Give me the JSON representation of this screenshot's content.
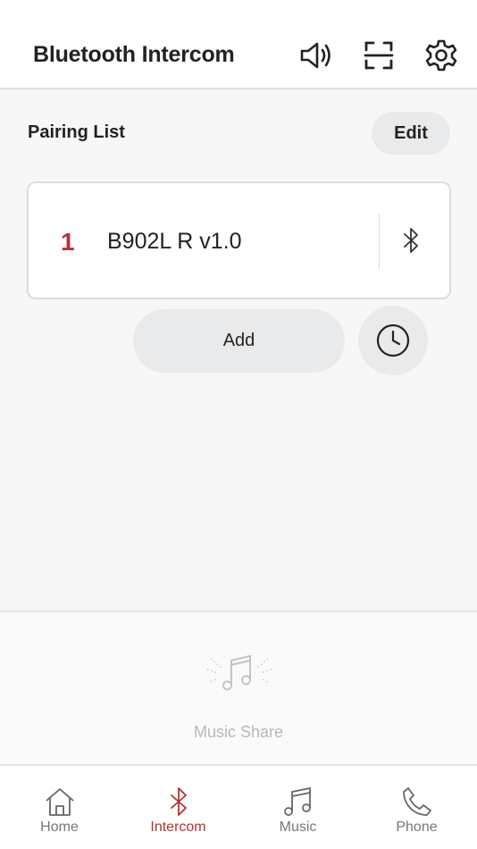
{
  "header": {
    "title": "Bluetooth Intercom",
    "icons": [
      "speaker-volume-icon",
      "scan-icon",
      "gear-icon"
    ]
  },
  "pairing": {
    "section_title": "Pairing List",
    "edit_label": "Edit",
    "items": [
      {
        "number": "1",
        "name": "B902L R v1.0",
        "icon": "bluetooth-icon"
      }
    ],
    "add_label": "Add",
    "history_icon": "clock-icon"
  },
  "music_share": {
    "label": "Music Share",
    "icon": "music-share-icon"
  },
  "tabbar": {
    "active": "Intercom",
    "accent_color": "#b3342f",
    "tabs": [
      {
        "label": "Home",
        "icon": "home-icon"
      },
      {
        "label": "Intercom",
        "icon": "bluetooth-icon"
      },
      {
        "label": "Music",
        "icon": "music-note-icon"
      },
      {
        "label": "Phone",
        "icon": "phone-icon"
      }
    ]
  }
}
